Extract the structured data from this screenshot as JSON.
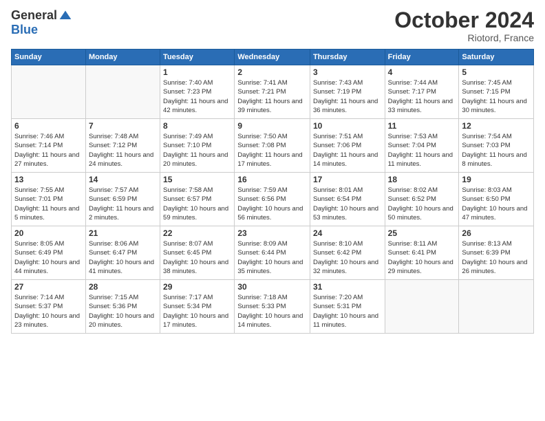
{
  "header": {
    "logo": {
      "general": "General",
      "blue": "Blue"
    },
    "title": "October 2024",
    "location": "Riotord, France"
  },
  "weekdays": [
    "Sunday",
    "Monday",
    "Tuesday",
    "Wednesday",
    "Thursday",
    "Friday",
    "Saturday"
  ],
  "weeks": [
    [
      {
        "day": null,
        "info": null
      },
      {
        "day": null,
        "info": null
      },
      {
        "day": "1",
        "info": "Sunrise: 7:40 AM\nSunset: 7:23 PM\nDaylight: 11 hours and 42 minutes."
      },
      {
        "day": "2",
        "info": "Sunrise: 7:41 AM\nSunset: 7:21 PM\nDaylight: 11 hours and 39 minutes."
      },
      {
        "day": "3",
        "info": "Sunrise: 7:43 AM\nSunset: 7:19 PM\nDaylight: 11 hours and 36 minutes."
      },
      {
        "day": "4",
        "info": "Sunrise: 7:44 AM\nSunset: 7:17 PM\nDaylight: 11 hours and 33 minutes."
      },
      {
        "day": "5",
        "info": "Sunrise: 7:45 AM\nSunset: 7:15 PM\nDaylight: 11 hours and 30 minutes."
      }
    ],
    [
      {
        "day": "6",
        "info": "Sunrise: 7:46 AM\nSunset: 7:14 PM\nDaylight: 11 hours and 27 minutes."
      },
      {
        "day": "7",
        "info": "Sunrise: 7:48 AM\nSunset: 7:12 PM\nDaylight: 11 hours and 24 minutes."
      },
      {
        "day": "8",
        "info": "Sunrise: 7:49 AM\nSunset: 7:10 PM\nDaylight: 11 hours and 20 minutes."
      },
      {
        "day": "9",
        "info": "Sunrise: 7:50 AM\nSunset: 7:08 PM\nDaylight: 11 hours and 17 minutes."
      },
      {
        "day": "10",
        "info": "Sunrise: 7:51 AM\nSunset: 7:06 PM\nDaylight: 11 hours and 14 minutes."
      },
      {
        "day": "11",
        "info": "Sunrise: 7:53 AM\nSunset: 7:04 PM\nDaylight: 11 hours and 11 minutes."
      },
      {
        "day": "12",
        "info": "Sunrise: 7:54 AM\nSunset: 7:03 PM\nDaylight: 11 hours and 8 minutes."
      }
    ],
    [
      {
        "day": "13",
        "info": "Sunrise: 7:55 AM\nSunset: 7:01 PM\nDaylight: 11 hours and 5 minutes."
      },
      {
        "day": "14",
        "info": "Sunrise: 7:57 AM\nSunset: 6:59 PM\nDaylight: 11 hours and 2 minutes."
      },
      {
        "day": "15",
        "info": "Sunrise: 7:58 AM\nSunset: 6:57 PM\nDaylight: 10 hours and 59 minutes."
      },
      {
        "day": "16",
        "info": "Sunrise: 7:59 AM\nSunset: 6:56 PM\nDaylight: 10 hours and 56 minutes."
      },
      {
        "day": "17",
        "info": "Sunrise: 8:01 AM\nSunset: 6:54 PM\nDaylight: 10 hours and 53 minutes."
      },
      {
        "day": "18",
        "info": "Sunrise: 8:02 AM\nSunset: 6:52 PM\nDaylight: 10 hours and 50 minutes."
      },
      {
        "day": "19",
        "info": "Sunrise: 8:03 AM\nSunset: 6:50 PM\nDaylight: 10 hours and 47 minutes."
      }
    ],
    [
      {
        "day": "20",
        "info": "Sunrise: 8:05 AM\nSunset: 6:49 PM\nDaylight: 10 hours and 44 minutes."
      },
      {
        "day": "21",
        "info": "Sunrise: 8:06 AM\nSunset: 6:47 PM\nDaylight: 10 hours and 41 minutes."
      },
      {
        "day": "22",
        "info": "Sunrise: 8:07 AM\nSunset: 6:45 PM\nDaylight: 10 hours and 38 minutes."
      },
      {
        "day": "23",
        "info": "Sunrise: 8:09 AM\nSunset: 6:44 PM\nDaylight: 10 hours and 35 minutes."
      },
      {
        "day": "24",
        "info": "Sunrise: 8:10 AM\nSunset: 6:42 PM\nDaylight: 10 hours and 32 minutes."
      },
      {
        "day": "25",
        "info": "Sunrise: 8:11 AM\nSunset: 6:41 PM\nDaylight: 10 hours and 29 minutes."
      },
      {
        "day": "26",
        "info": "Sunrise: 8:13 AM\nSunset: 6:39 PM\nDaylight: 10 hours and 26 minutes."
      }
    ],
    [
      {
        "day": "27",
        "info": "Sunrise: 7:14 AM\nSunset: 5:37 PM\nDaylight: 10 hours and 23 minutes."
      },
      {
        "day": "28",
        "info": "Sunrise: 7:15 AM\nSunset: 5:36 PM\nDaylight: 10 hours and 20 minutes."
      },
      {
        "day": "29",
        "info": "Sunrise: 7:17 AM\nSunset: 5:34 PM\nDaylight: 10 hours and 17 minutes."
      },
      {
        "day": "30",
        "info": "Sunrise: 7:18 AM\nSunset: 5:33 PM\nDaylight: 10 hours and 14 minutes."
      },
      {
        "day": "31",
        "info": "Sunrise: 7:20 AM\nSunset: 5:31 PM\nDaylight: 10 hours and 11 minutes."
      },
      {
        "day": null,
        "info": null
      },
      {
        "day": null,
        "info": null
      }
    ]
  ]
}
